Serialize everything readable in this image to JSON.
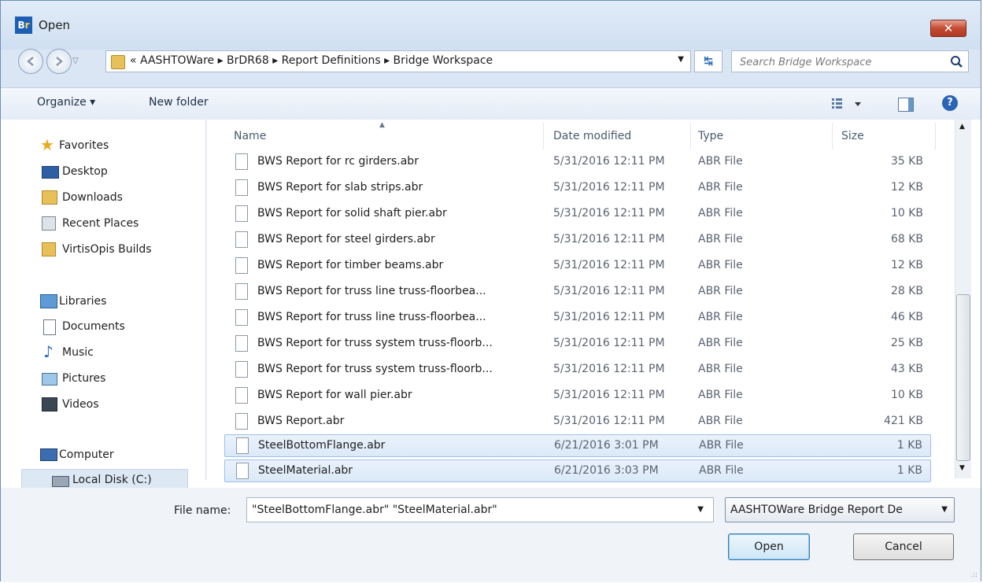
{
  "window": {
    "title": "Open",
    "app_icon": "Br"
  },
  "nav": {
    "breadcrumb": [
      "«",
      "AASHTOWare",
      "▸",
      "BrDR68",
      "▸",
      "Report Definitions",
      "▸",
      "Bridge Workspace"
    ],
    "breadcrumb_text": "«  AASHTOWare  ▸  BrDR68  ▸  Report Definitions  ▸  Bridge Workspace",
    "search_placeholder": "Search Bridge Workspace"
  },
  "toolbar": {
    "organize_label": "Organize ▾",
    "new_folder_label": "New folder"
  },
  "sidebar": {
    "items": [
      {
        "label": "Favorites",
        "icon": "star-icon"
      },
      {
        "label": "Desktop",
        "icon": "desktop-icon"
      },
      {
        "label": "Downloads",
        "icon": "downloads-folder-icon"
      },
      {
        "label": "Recent Places",
        "icon": "recent-places-icon"
      },
      {
        "label": "VirtisOpis Builds",
        "icon": "folder-icon"
      },
      {
        "label": "Libraries",
        "icon": "libraries-icon"
      },
      {
        "label": "Documents",
        "icon": "documents-icon"
      },
      {
        "label": "Music",
        "icon": "music-icon"
      },
      {
        "label": "Pictures",
        "icon": "pictures-icon"
      },
      {
        "label": "Videos",
        "icon": "videos-icon"
      },
      {
        "label": "Computer",
        "icon": "computer-icon"
      },
      {
        "label": "Local Disk (C:)",
        "icon": "disk-icon"
      }
    ]
  },
  "columns": {
    "name": "Name",
    "date": "Date modified",
    "type": "Type",
    "size": "Size"
  },
  "files": [
    {
      "name": "BWS Report for rc girders.abr",
      "date": "5/31/2016 12:11 PM",
      "type": "ABR File",
      "size": "35 KB"
    },
    {
      "name": "BWS Report for slab strips.abr",
      "date": "5/31/2016 12:11 PM",
      "type": "ABR File",
      "size": "12 KB"
    },
    {
      "name": "BWS Report for solid shaft pier.abr",
      "date": "5/31/2016 12:11 PM",
      "type": "ABR File",
      "size": "10 KB"
    },
    {
      "name": "BWS Report for steel girders.abr",
      "date": "5/31/2016 12:11 PM",
      "type": "ABR File",
      "size": "68 KB"
    },
    {
      "name": "BWS Report for timber beams.abr",
      "date": "5/31/2016 12:11 PM",
      "type": "ABR File",
      "size": "12 KB"
    },
    {
      "name": "BWS Report for truss line truss-floorbea...",
      "date": "5/31/2016 12:11 PM",
      "type": "ABR File",
      "size": "28 KB"
    },
    {
      "name": "BWS Report for truss line truss-floorbea...",
      "date": "5/31/2016 12:11 PM",
      "type": "ABR File",
      "size": "46 KB"
    },
    {
      "name": "BWS Report for truss system truss-floorb...",
      "date": "5/31/2016 12:11 PM",
      "type": "ABR File",
      "size": "25 KB"
    },
    {
      "name": "BWS Report for truss system truss-floorb...",
      "date": "5/31/2016 12:11 PM",
      "type": "ABR File",
      "size": "43 KB"
    },
    {
      "name": "BWS Report for wall pier.abr",
      "date": "5/31/2016 12:11 PM",
      "type": "ABR File",
      "size": "10 KB"
    },
    {
      "name": "BWS Report.abr",
      "date": "5/31/2016 12:11 PM",
      "type": "ABR File",
      "size": "421 KB"
    },
    {
      "name": "SteelBottomFlange.abr",
      "date": "6/21/2016 3:01 PM",
      "type": "ABR File",
      "size": "1 KB",
      "selected": true
    },
    {
      "name": "SteelMaterial.abr",
      "date": "6/21/2016 3:03 PM",
      "type": "ABR File",
      "size": "1 KB",
      "selected": true
    }
  ],
  "footer": {
    "file_name_label": "File name:",
    "file_name_value": "\"SteelBottomFlange.abr\" \"SteelMaterial.abr\"",
    "filter_value": "AASHTOWare Bridge Report De",
    "open_label": "Open",
    "cancel_label": "Cancel"
  },
  "colors": {
    "selection": "#dbe9f8",
    "accent": "#2a64b5",
    "close": "#c44b33"
  }
}
